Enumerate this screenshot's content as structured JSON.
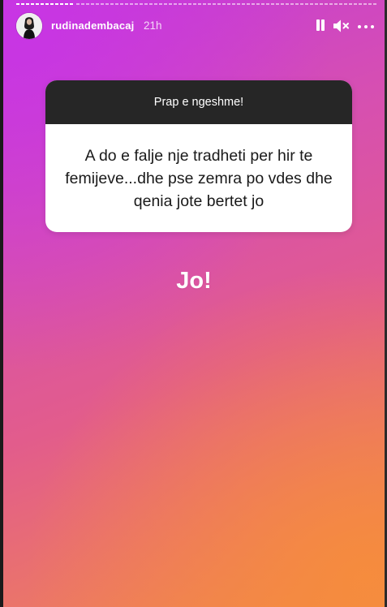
{
  "story": {
    "username": "rudinadembacaj",
    "time_ago": "21h"
  },
  "controls": {
    "pause": "pause-icon",
    "mute": "speaker-muted-icon",
    "more": "more-options-icon"
  },
  "question_sticker": {
    "prompt": "Prap e ngeshme!",
    "question": "A do e falje nje tradheti per hir te femijeve...dhe pse zemra po vdes dhe qenia jote bertet jo"
  },
  "answer_text": "Jo!",
  "colors": {
    "gradient_top_left": "#c834e6",
    "gradient_bottom_right": "#f08a48",
    "sticker_header": "#262626",
    "sticker_body": "#ffffff"
  }
}
